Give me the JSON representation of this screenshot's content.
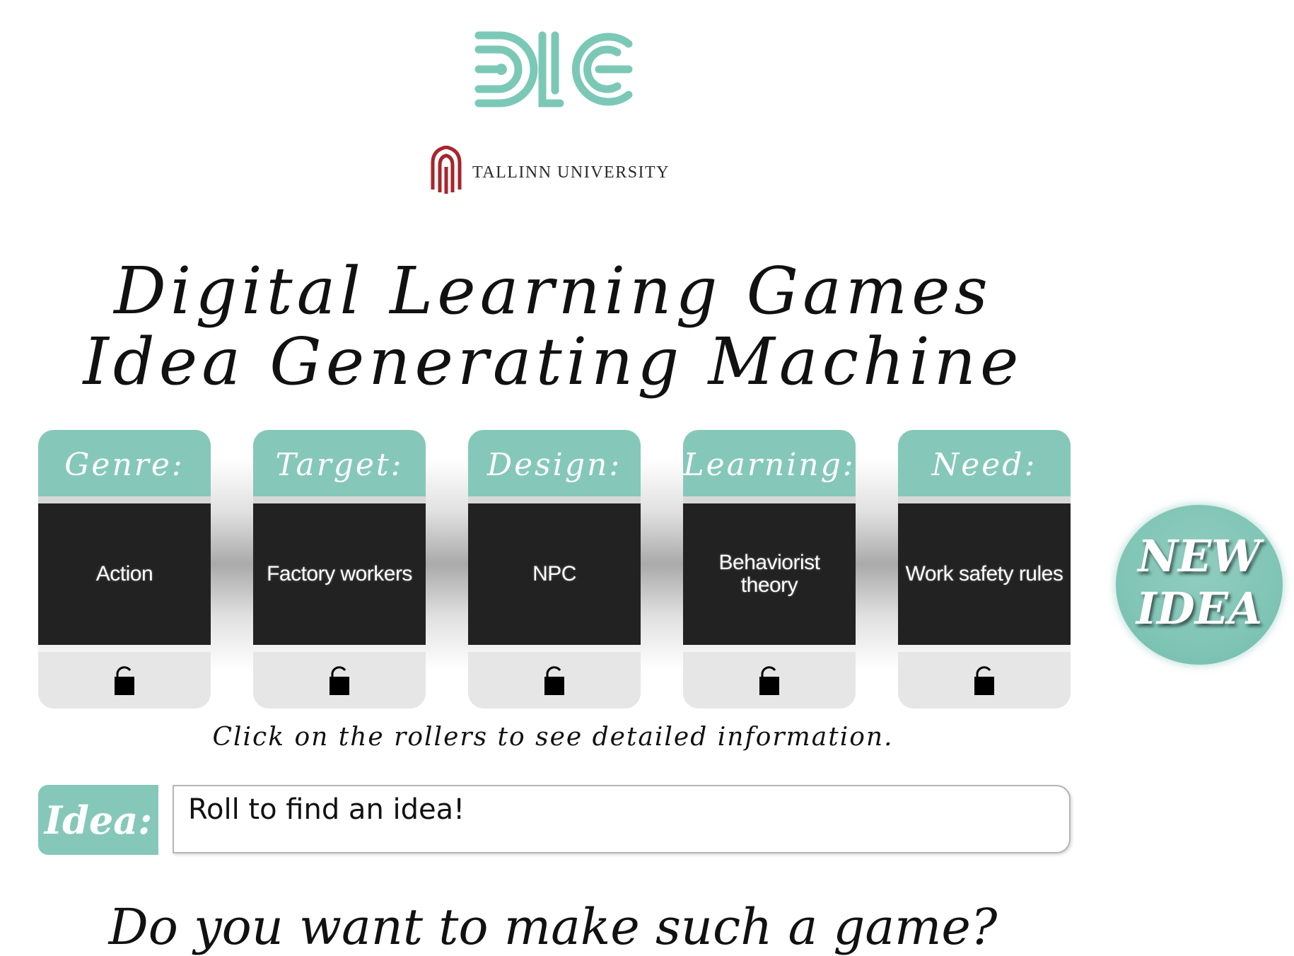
{
  "brand": {
    "logo_text": "DLG",
    "university": "TALLINN UNIVERSITY"
  },
  "title": {
    "line1": "Digital Learning Games",
    "line2": "Idea Generating Machine"
  },
  "reels": [
    {
      "label": "Genre:",
      "value": "Action",
      "locked": false
    },
    {
      "label": "Target:",
      "value": "Factory workers",
      "locked": false
    },
    {
      "label": "Design:",
      "value": "NPC",
      "locked": false
    },
    {
      "label": "Learning:",
      "value": "Behaviorist theory",
      "locked": false
    },
    {
      "label": "Need:",
      "value": "Work safety rules",
      "locked": false
    }
  ],
  "new_idea": {
    "line1": "NEW",
    "line2": "IDEA"
  },
  "hint": "Click on the rollers to see detailed information.",
  "idea": {
    "label": "Idea:",
    "text": "Roll to find an idea!"
  },
  "question": "Do you want to make such a game?",
  "colors": {
    "accent": "#85c8b9",
    "reel_window": "#222222",
    "reel_foot": "#e6e6e6",
    "university_red": "#a8252b"
  },
  "icons": {
    "lock": "open-padlock-icon",
    "university_emblem": "tallinn-university-emblem"
  }
}
